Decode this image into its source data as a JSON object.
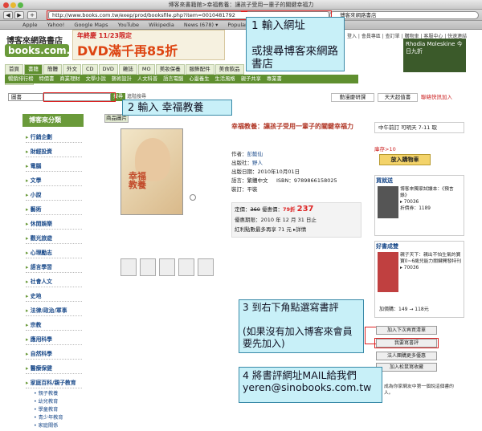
{
  "window": {
    "title": "博客來書籍館>幸福教養：讓孩子受用一輩子的關鍵幸福力",
    "url": "http://www.books.com.tw/exep/prod/booksfile.php?item=0010481792",
    "search_value": "博客來網路書店",
    "nav_back": "◀",
    "nav_fwd": "▶",
    "add_btn": "+"
  },
  "bookmarks": [
    "Apple",
    "Yahoo!",
    "Google Maps",
    "YouTube",
    "Wikipedia",
    "News (678) ▾",
    "Popular ▾"
  ],
  "site": {
    "logo_cn": "博客來網路書店",
    "logo_en": "books.com.tw",
    "banner_line1": "年終慶 11/23限定",
    "banner_line2": "DVD滿千再85折",
    "toplinks": "登入 | 會員專區 | 查訂單 | 購物車 | 客服中心 | 快速連結",
    "ad_text": "Rhodia Moleskine 今日九折"
  },
  "nav_tabs": [
    "首頁",
    "書籍",
    "簡體",
    "外文",
    "CD",
    "DVD",
    "雜誌",
    "MO",
    "美妝保養",
    "服飾配件",
    "美食飲品",
    "創意生活"
  ],
  "subnav": [
    "暢銷排行榜",
    "特價書",
    "商業理財",
    "文學小說",
    "藝術設計",
    "人文科普",
    "語言電腦",
    "心靈養生",
    "生活風格",
    "親子共享",
    "專業書"
  ],
  "search": {
    "category": "圖書",
    "button": "搜尋",
    "advanced": "進階搜尋"
  },
  "right_buttons": [
    "動漫慶研課",
    "天天超值書",
    "聯絡快訊加入"
  ],
  "sidebar": {
    "header": "博客來分類",
    "items": [
      "行銷企劃",
      "財經投資",
      "電腦",
      "文學",
      "小說",
      "藝術",
      "休閒娛樂",
      "觀光旅遊",
      "心理勵志",
      "語言學習",
      "社會人文",
      "史地",
      "法律/政治/軍事",
      "宗教",
      "應用科學",
      "自然科學",
      "醫療保健",
      "家庭百科/親子教育"
    ],
    "subitems": [
      "親子教養",
      "幼兒教育",
      "學童教育",
      "青少年教育",
      "家庭關係"
    ]
  },
  "product": {
    "image_tab": "商品圖片",
    "cover_title": "幸福教養",
    "today_label": "今日 66 折",
    "title": "幸福教養：讓孩子受用一輩子的關鍵幸福力",
    "author_label": "作者：",
    "author": "彭懿仙",
    "publisher_label": "出版社：",
    "publisher": "野人",
    "date": "出版日期：2010年10月01日",
    "lang": "語言：繁體中文",
    "isbn": "ISBN：9789866158025",
    "binding": "裝訂：平裝",
    "list_price_label": "定價：",
    "list_price": "360",
    "discount_label": "優惠價：",
    "discount": "79折",
    "price": "237",
    "period": "優惠期限：2010 年 12 月 31 日止",
    "points": "紅利點數最多再享 71 元 ▸詳情"
  },
  "right": {
    "delivery": "中午前訂 可明天 7-11 取",
    "stock": "庫存>10",
    "cart_button": "放入購物車",
    "sec1_header": "買就送",
    "sec1_text": "博客來獨家試讀本：《預言錄》\n▸ 70036\n折價券：1189",
    "sec2_header": "好書成雙",
    "sec2_text": "親子天下：親出不怕生氣的寶寶0~6歲兒能力關鍵開發特刊\n▸ 70036",
    "sec2_price": "加價購：149 → 118元",
    "btn_wish": "加入下次再買清單",
    "btn_review": "我要寫書評",
    "btn_group": "法人團購更多優惠",
    "btn_fav": "加入松鼠寫收藏",
    "donate": "成為你家網友中第一個說這個書的人。"
  },
  "notes": {
    "note1": "1  輸入網址\n\n或搜尋博客來網路書店",
    "note2": "2  輸入  幸福教養",
    "note3": "3  到右下角點選寫書評\n\n(如果沒有加入博客來會員要先加入)",
    "note4": "4 將書評網址MAIL給我們\nyeren@sinobooks.com.tw"
  }
}
